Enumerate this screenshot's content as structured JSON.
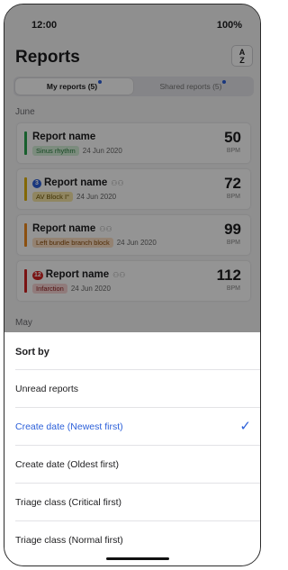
{
  "status_bar": {
    "time": "12:00",
    "battery": "100%"
  },
  "header": {
    "title": "Reports",
    "sort_icon_text": "A↓Z"
  },
  "tabs": [
    {
      "label": "My reports (5)",
      "active": true
    },
    {
      "label": "Shared reports (5)",
      "active": false
    }
  ],
  "sections": [
    {
      "label": "June"
    },
    {
      "label": "May"
    }
  ],
  "reports": [
    {
      "name": "Report name",
      "badge": "",
      "shared": false,
      "tag": "Sinus rhythm",
      "tag_color": "#d6f1d9",
      "date": "24 Jun 2020",
      "value": "50",
      "unit": "BPM",
      "bar_color": "#2aa44f"
    },
    {
      "name": "Report name",
      "badge": "3",
      "shared": true,
      "tag": "AV Block I°",
      "tag_color": "#f8e7a8",
      "date": "24 Jun 2020",
      "value": "72",
      "unit": "BPM",
      "bar_color": "#e2b30c"
    },
    {
      "name": "Report name",
      "badge": "",
      "shared": true,
      "tag": "Left bundle branch block",
      "tag_color": "#fde0c4",
      "date": "24 Jun 2020",
      "value": "99",
      "unit": "BPM",
      "bar_color": "#f08a1c"
    },
    {
      "name": "Report name",
      "badge": "12",
      "shared": true,
      "tag": "Infarction",
      "tag_color": "#f9d4d4",
      "date": "24 Jun 2020",
      "value": "112",
      "unit": "BPM",
      "bar_color": "#d32222"
    }
  ],
  "sort_sheet": {
    "title": "Sort by",
    "options": [
      {
        "label": "Unread reports",
        "selected": false
      },
      {
        "label": "Create date (Newest first)",
        "selected": true
      },
      {
        "label": "Create date (Oldest first)",
        "selected": false
      },
      {
        "label": "Triage class (Critical first)",
        "selected": false
      },
      {
        "label": "Triage class (Normal first)",
        "selected": false
      }
    ]
  },
  "icons": {
    "people": "people-icon",
    "check": "check-icon",
    "sort": "sort-az-icon"
  },
  "colors": {
    "accent": "#2b5fd9"
  }
}
